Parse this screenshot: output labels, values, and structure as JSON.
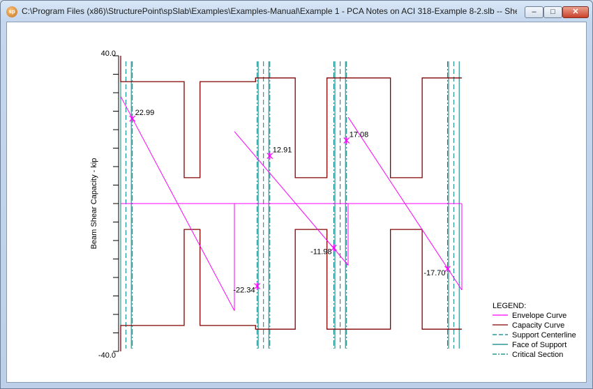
{
  "window": {
    "title": "C:\\Program Files (x86)\\StructurePoint\\spSlab\\Examples\\Examples-Manual\\Example 1 - PCA Notes on ACI 318-Example 8-2.slb -- She...",
    "icon": "sp-logo-icon",
    "controls": {
      "minimize": "–",
      "maximize": "□",
      "close": "✕"
    }
  },
  "colors": {
    "envelope": "#ff00ff",
    "capacity": "#800000",
    "support": "#008080"
  },
  "chart_data": {
    "type": "line",
    "ylabel": "Beam Shear Capacity - kip",
    "ylim": [
      -40.0,
      40.0
    ],
    "ytick_labels": [
      "40.0",
      "-40.0"
    ],
    "grid": false,
    "x_units_note": "",
    "spans": [
      {
        "support_left": 0.0,
        "support_right": 21.5
      },
      {
        "support_left": 21.5,
        "support_right": 43.0
      },
      {
        "support_left": 43.0,
        "support_right": 64.5
      }
    ],
    "envelope_curve": [
      {
        "x": [
          0.0,
          21.5
        ],
        "y": [
          29.0,
          -29.0
        ]
      },
      {
        "x": [
          21.5,
          43.0
        ],
        "y": [
          19.5,
          -16.7
        ]
      },
      {
        "x": [
          43.0,
          64.5
        ],
        "y": [
          23.4,
          -23.4
        ]
      }
    ],
    "zero_line": {
      "x": [
        0.0,
        64.5
      ],
      "y": [
        0.0,
        0.0
      ]
    },
    "capacity_curve": {
      "top": {
        "x": [
          0.0,
          0.0,
          12.0,
          12.0,
          15.0,
          15.0,
          25.5,
          25.5,
          33.0,
          33.0,
          39.0,
          39.0,
          51.0,
          51.0,
          57.0,
          57.0,
          64.5
        ],
        "y": [
          40.0,
          33.0,
          33.0,
          7.0,
          7.0,
          33.0,
          33.0,
          34.0,
          34.0,
          7.0,
          7.0,
          34.0,
          34.0,
          7.0,
          7.0,
          34.0,
          34.0
        ]
      },
      "bottom": {
        "x": [
          0.0,
          0.0,
          12.0,
          12.0,
          15.0,
          15.0,
          25.5,
          25.5,
          33.0,
          33.0,
          39.0,
          39.0,
          51.0,
          51.0,
          57.0,
          57.0,
          64.5
        ],
        "y": [
          -40.0,
          -33.0,
          -33.0,
          -7.0,
          -7.0,
          -33.0,
          -33.0,
          -34.0,
          -34.0,
          -7.0,
          -7.0,
          -34.0,
          -34.0,
          -7.0,
          -7.0,
          -34.0,
          -34.0
        ]
      }
    },
    "support_centerlines": [
      1.0,
      27.0,
      41.5,
      63.0
    ],
    "faces_of_support": [
      0.0,
      2.0,
      26.0,
      28.0,
      40.5,
      42.5,
      62.0,
      64.0
    ],
    "critical_sections": [
      2.2,
      25.8,
      28.2,
      40.3,
      42.7,
      61.8
    ],
    "critical_points": [
      {
        "x": 2.2,
        "y": 22.99,
        "label": "22.99"
      },
      {
        "x": 25.8,
        "y": -22.34,
        "label": "-22.34"
      },
      {
        "x": 28.2,
        "y": 12.91,
        "label": "12.91"
      },
      {
        "x": 40.3,
        "y": -11.98,
        "label": "-11.98"
      },
      {
        "x": 42.7,
        "y": 17.08,
        "label": "17.08"
      },
      {
        "x": 61.8,
        "y": -17.7,
        "label": "-17.70"
      }
    ],
    "legend": {
      "title": "LEGEND:",
      "position": "bottom-right",
      "entries": [
        {
          "label": "Envelope Curve",
          "style": "solid",
          "color": "#ff00ff"
        },
        {
          "label": "Capacity Curve",
          "style": "solid",
          "color": "#800000"
        },
        {
          "label": "Support Centerline",
          "style": "dash",
          "color": "#008080"
        },
        {
          "label": "Face of Support",
          "style": "solid",
          "color": "#008080"
        },
        {
          "label": "Critical Section",
          "style": "dashdot",
          "color": "#008080"
        }
      ]
    }
  }
}
